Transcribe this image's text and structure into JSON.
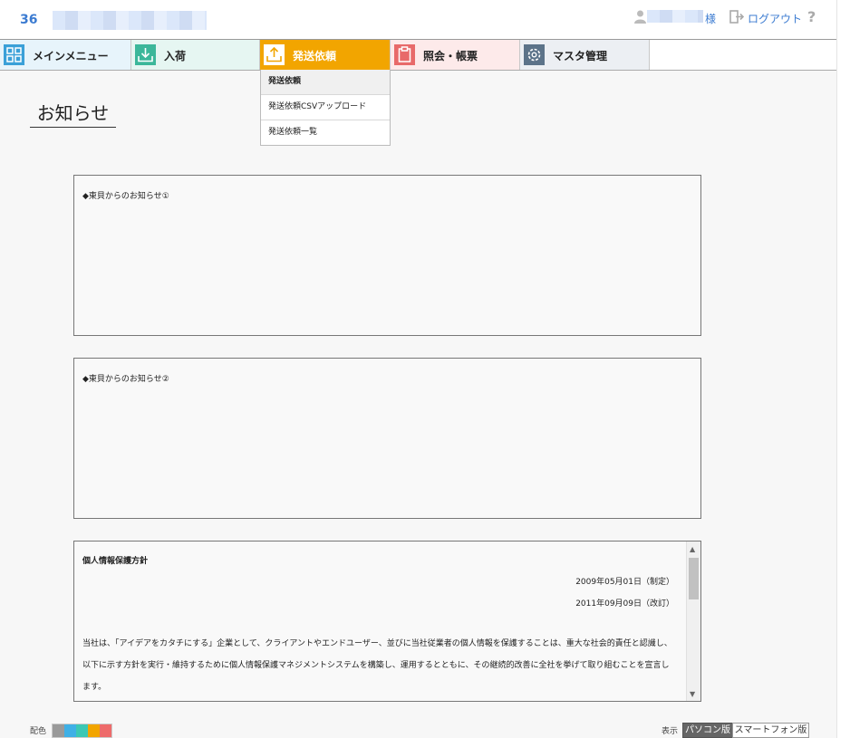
{
  "header": {
    "company_code": "36",
    "honorific": "様",
    "logout_label": "ログアウト",
    "help_label": "?"
  },
  "nav": {
    "tabs": [
      {
        "label": "メインメニュー",
        "icon": "grid-icon",
        "color": "#3aa0d8"
      },
      {
        "label": "入荷",
        "icon": "download-tray-icon",
        "color": "#3cb79a"
      },
      {
        "label": "発送依頼",
        "icon": "upload-tray-icon",
        "color": "#f2a500"
      },
      {
        "label": "照会・帳票",
        "icon": "clipboard-icon",
        "color": "#e86a6a"
      },
      {
        "label": "マスタ管理",
        "icon": "gear-icon",
        "color": "#5c7389"
      }
    ]
  },
  "dropdown": {
    "items": [
      {
        "label": "発送依頼"
      },
      {
        "label": "発送依頼CSVアップロード"
      },
      {
        "label": "発送依頼一覧"
      }
    ]
  },
  "page": {
    "title": "お知らせ"
  },
  "notices": [
    {
      "title": "◆東貝からのお知らせ①"
    },
    {
      "title": "◆東貝からのお知らせ②"
    }
  ],
  "policy": {
    "title": "個人情報保護方針",
    "date_established": "2009年05月01日（制定）",
    "date_revised": "2011年09月09日（改訂）",
    "body": "当社は、「アイデアをカタチにする」企業として、クライアントやエンドユーザー、並びに当社従業者の個人情報を保護することは、重大な社会的責任と認識し、以下に示す方針を実行・維持するために個人情報保護マネジメントシステムを構築し、運用するとともに、その継続的改善に全社を挙げて取り組むことを宣言します。"
  },
  "footer": {
    "color_label": "配色",
    "colors": [
      "#9a9a9a",
      "#3fb0e6",
      "#3cc8b4",
      "#f2a500",
      "#ee6b6b"
    ],
    "display_label": "表示",
    "pc_label": "パソコン版",
    "sp_label": "スマートフォン版"
  }
}
